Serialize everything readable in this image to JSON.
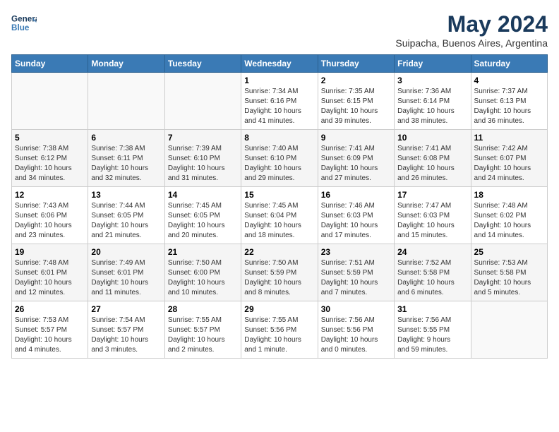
{
  "header": {
    "logo_line1": "General",
    "logo_line2": "Blue",
    "month_title": "May 2024",
    "location": "Suipacha, Buenos Aires, Argentina"
  },
  "columns": [
    "Sunday",
    "Monday",
    "Tuesday",
    "Wednesday",
    "Thursday",
    "Friday",
    "Saturday"
  ],
  "weeks": [
    [
      {
        "day": "",
        "info": ""
      },
      {
        "day": "",
        "info": ""
      },
      {
        "day": "",
        "info": ""
      },
      {
        "day": "1",
        "info": "Sunrise: 7:34 AM\nSunset: 6:16 PM\nDaylight: 10 hours\nand 41 minutes."
      },
      {
        "day": "2",
        "info": "Sunrise: 7:35 AM\nSunset: 6:15 PM\nDaylight: 10 hours\nand 39 minutes."
      },
      {
        "day": "3",
        "info": "Sunrise: 7:36 AM\nSunset: 6:14 PM\nDaylight: 10 hours\nand 38 minutes."
      },
      {
        "day": "4",
        "info": "Sunrise: 7:37 AM\nSunset: 6:13 PM\nDaylight: 10 hours\nand 36 minutes."
      }
    ],
    [
      {
        "day": "5",
        "info": "Sunrise: 7:38 AM\nSunset: 6:12 PM\nDaylight: 10 hours\nand 34 minutes."
      },
      {
        "day": "6",
        "info": "Sunrise: 7:38 AM\nSunset: 6:11 PM\nDaylight: 10 hours\nand 32 minutes."
      },
      {
        "day": "7",
        "info": "Sunrise: 7:39 AM\nSunset: 6:10 PM\nDaylight: 10 hours\nand 31 minutes."
      },
      {
        "day": "8",
        "info": "Sunrise: 7:40 AM\nSunset: 6:10 PM\nDaylight: 10 hours\nand 29 minutes."
      },
      {
        "day": "9",
        "info": "Sunrise: 7:41 AM\nSunset: 6:09 PM\nDaylight: 10 hours\nand 27 minutes."
      },
      {
        "day": "10",
        "info": "Sunrise: 7:41 AM\nSunset: 6:08 PM\nDaylight: 10 hours\nand 26 minutes."
      },
      {
        "day": "11",
        "info": "Sunrise: 7:42 AM\nSunset: 6:07 PM\nDaylight: 10 hours\nand 24 minutes."
      }
    ],
    [
      {
        "day": "12",
        "info": "Sunrise: 7:43 AM\nSunset: 6:06 PM\nDaylight: 10 hours\nand 23 minutes."
      },
      {
        "day": "13",
        "info": "Sunrise: 7:44 AM\nSunset: 6:05 PM\nDaylight: 10 hours\nand 21 minutes."
      },
      {
        "day": "14",
        "info": "Sunrise: 7:45 AM\nSunset: 6:05 PM\nDaylight: 10 hours\nand 20 minutes."
      },
      {
        "day": "15",
        "info": "Sunrise: 7:45 AM\nSunset: 6:04 PM\nDaylight: 10 hours\nand 18 minutes."
      },
      {
        "day": "16",
        "info": "Sunrise: 7:46 AM\nSunset: 6:03 PM\nDaylight: 10 hours\nand 17 minutes."
      },
      {
        "day": "17",
        "info": "Sunrise: 7:47 AM\nSunset: 6:03 PM\nDaylight: 10 hours\nand 15 minutes."
      },
      {
        "day": "18",
        "info": "Sunrise: 7:48 AM\nSunset: 6:02 PM\nDaylight: 10 hours\nand 14 minutes."
      }
    ],
    [
      {
        "day": "19",
        "info": "Sunrise: 7:48 AM\nSunset: 6:01 PM\nDaylight: 10 hours\nand 12 minutes."
      },
      {
        "day": "20",
        "info": "Sunrise: 7:49 AM\nSunset: 6:01 PM\nDaylight: 10 hours\nand 11 minutes."
      },
      {
        "day": "21",
        "info": "Sunrise: 7:50 AM\nSunset: 6:00 PM\nDaylight: 10 hours\nand 10 minutes."
      },
      {
        "day": "22",
        "info": "Sunrise: 7:50 AM\nSunset: 5:59 PM\nDaylight: 10 hours\nand 8 minutes."
      },
      {
        "day": "23",
        "info": "Sunrise: 7:51 AM\nSunset: 5:59 PM\nDaylight: 10 hours\nand 7 minutes."
      },
      {
        "day": "24",
        "info": "Sunrise: 7:52 AM\nSunset: 5:58 PM\nDaylight: 10 hours\nand 6 minutes."
      },
      {
        "day": "25",
        "info": "Sunrise: 7:53 AM\nSunset: 5:58 PM\nDaylight: 10 hours\nand 5 minutes."
      }
    ],
    [
      {
        "day": "26",
        "info": "Sunrise: 7:53 AM\nSunset: 5:57 PM\nDaylight: 10 hours\nand 4 minutes."
      },
      {
        "day": "27",
        "info": "Sunrise: 7:54 AM\nSunset: 5:57 PM\nDaylight: 10 hours\nand 3 minutes."
      },
      {
        "day": "28",
        "info": "Sunrise: 7:55 AM\nSunset: 5:57 PM\nDaylight: 10 hours\nand 2 minutes."
      },
      {
        "day": "29",
        "info": "Sunrise: 7:55 AM\nSunset: 5:56 PM\nDaylight: 10 hours\nand 1 minute."
      },
      {
        "day": "30",
        "info": "Sunrise: 7:56 AM\nSunset: 5:56 PM\nDaylight: 10 hours\nand 0 minutes."
      },
      {
        "day": "31",
        "info": "Sunrise: 7:56 AM\nSunset: 5:55 PM\nDaylight: 9 hours\nand 59 minutes."
      },
      {
        "day": "",
        "info": ""
      }
    ]
  ]
}
